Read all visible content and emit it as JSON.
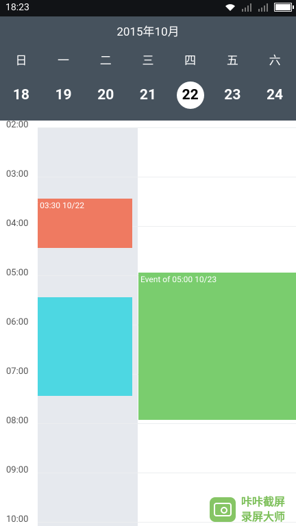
{
  "status_bar": {
    "time": "18:23"
  },
  "header": {
    "month_title": "2015年10月",
    "weekdays": [
      "日",
      "一",
      "二",
      "三",
      "四",
      "五",
      "六"
    ],
    "dates": [
      "18",
      "19",
      "20",
      "21",
      "22",
      "23",
      "24"
    ],
    "selected_date": "22"
  },
  "timeline": {
    "hours": [
      "02:00",
      "03:00",
      "04:00",
      "05:00",
      "06:00",
      "07:00",
      "08:00",
      "09:00",
      "10:00"
    ]
  },
  "events": {
    "orange": {
      "title": "f 03:30 10/22",
      "color": "#ef7a61"
    },
    "cyan": {
      "title": "",
      "color": "#4dd7e2"
    },
    "green": {
      "title": "Event of 05:00 10/23",
      "color": "#7acd6e"
    }
  },
  "watermark": {
    "line1": "咔咔截屏",
    "line2": "录屏大师"
  },
  "colors": {
    "header_bg": "#46525d",
    "day_column": "#e6e9ee",
    "status_bg": "#111316"
  }
}
